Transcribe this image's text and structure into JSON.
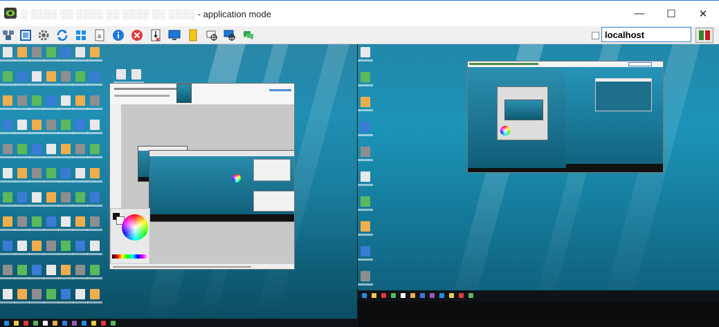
{
  "window": {
    "title_garbled": "░ ░░░░ ░░ ░░░░ ░░ ░░░░ ░░ ░░░░",
    "title_mode": " - application mode",
    "minimize_glyph": "—",
    "maximize_glyph": "☐",
    "close_glyph": "✕"
  },
  "toolbar": {
    "icons": [
      "network-icon",
      "fullscreen-icon",
      "settings-gear-icon",
      "refresh-icon",
      "windows-logo-icon",
      "file-document-icon",
      "info-icon",
      "stop-icon",
      "download-file-icon",
      "monitor-icon",
      "sticky-note-icon",
      "capture-target-icon",
      "screen-capture-target-icon",
      "chat-icon"
    ],
    "host_value": "localhost"
  },
  "colors": {
    "title_accent": "#2f7fd8",
    "toolbar_bg": "#f0f0f0",
    "host_border": "#3c7fc4",
    "connect_green": "#2f8a2f",
    "connect_red": "#c21e1e",
    "desktop_blue": "#1f8fb3",
    "taskbar_dark": "#101418"
  }
}
